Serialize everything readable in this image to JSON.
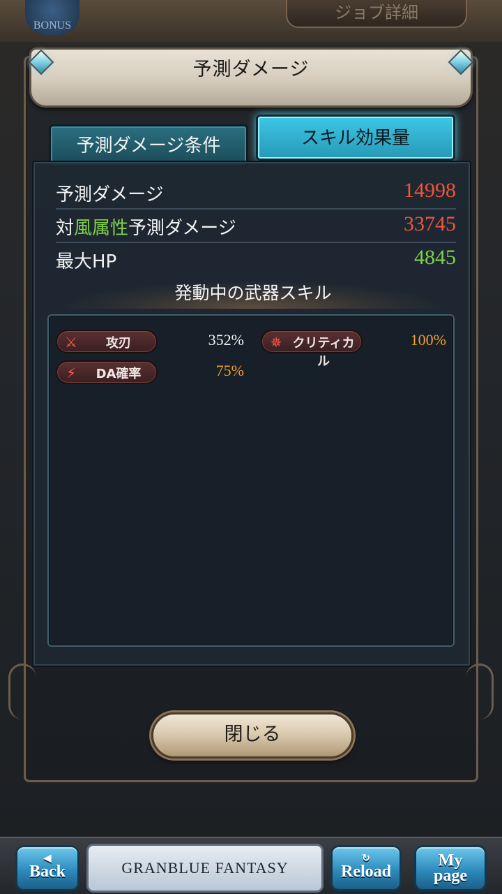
{
  "header": {
    "bonus_label": "BONUS",
    "job_detail_label": "ジョブ詳細"
  },
  "modal": {
    "title": "予測ダメージ",
    "tabs": [
      {
        "label": "予測ダメージ条件",
        "active": false
      },
      {
        "label": "スキル効果量",
        "active": true
      }
    ],
    "stats": [
      {
        "label_prefix": "",
        "label_highlight": "",
        "label_suffix": "予測ダメージ",
        "value": "14998",
        "color": "#f0553a"
      },
      {
        "label_prefix": "対",
        "label_highlight": "風属性",
        "label_suffix": "予測ダメージ",
        "value": "33745",
        "color": "#f0553a"
      },
      {
        "label_prefix": "",
        "label_highlight": "",
        "label_suffix": "最大HP",
        "value": "4845",
        "color": "#7fd24a"
      }
    ],
    "section_heading": "発動中の武器スキル",
    "skills": [
      {
        "name": "攻刃",
        "icon": "sword-icon",
        "value": "352%",
        "value_color": "#f4f4f4"
      },
      {
        "name": "クリティカル",
        "icon": "burst-icon",
        "value": "100%",
        "value_color": "#f0a030"
      },
      {
        "name": "DA確率",
        "icon": "double-slash-icon",
        "value": "75%",
        "value_color": "#f0a030"
      }
    ],
    "close_label": "閉じる"
  },
  "nav": {
    "back_label": "Back",
    "logo_text": "GRANBLUE FANTASY",
    "reload_label": "Reload",
    "mypage_line1": "My",
    "mypage_line2": "page"
  }
}
